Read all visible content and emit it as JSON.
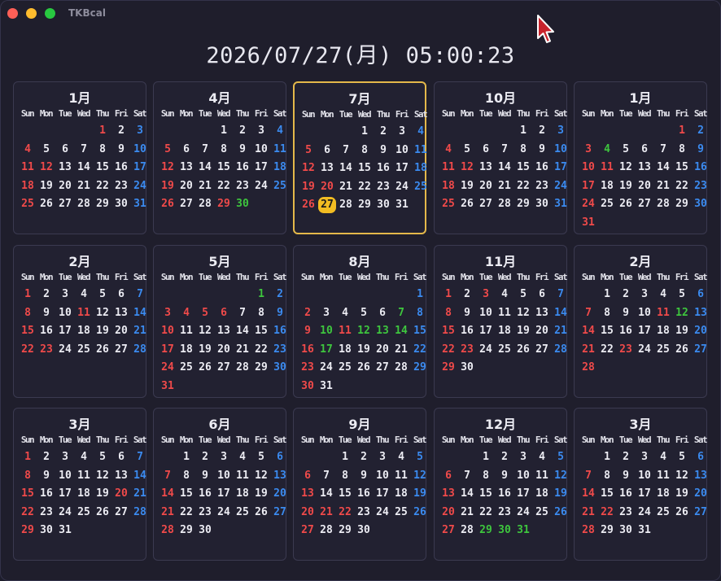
{
  "app": {
    "title": "TKBcal"
  },
  "clock": {
    "text": "2026/07/27(月) 05:00:23"
  },
  "weekdays": [
    "Sun",
    "Mon",
    "Tue",
    "Wed",
    "Thu",
    "Fri",
    "Sat"
  ],
  "colors": {
    "sunday": "#f04a4a",
    "saturday": "#3b8bf0",
    "holiday": "#f04a4a",
    "green": "#3ec63e",
    "today": "#f2bc22",
    "current_border": "#e4b84a"
  },
  "months": [
    {
      "title": "1月",
      "start": 4,
      "days": 31,
      "red": [
        1,
        12
      ],
      "green": []
    },
    {
      "title": "4月",
      "start": 3,
      "days": 30,
      "red": [
        29
      ],
      "green": [
        30
      ]
    },
    {
      "title": "7月",
      "start": 3,
      "days": 31,
      "red": [
        20
      ],
      "green": [],
      "today": 27,
      "current": true
    },
    {
      "title": "10月",
      "start": 4,
      "days": 31,
      "red": [
        12
      ],
      "green": []
    },
    {
      "title": "1月",
      "start": 5,
      "days": 31,
      "red": [
        1,
        11
      ],
      "green": [
        4
      ]
    },
    {
      "title": "2月",
      "start": 0,
      "days": 28,
      "red": [
        11,
        23
      ],
      "green": []
    },
    {
      "title": "5月",
      "start": 5,
      "days": 31,
      "red": [
        3,
        4,
        5,
        6
      ],
      "green": [
        1
      ]
    },
    {
      "title": "8月",
      "start": 6,
      "days": 31,
      "red": [
        11
      ],
      "green": [
        7,
        10,
        12,
        13,
        14,
        17
      ]
    },
    {
      "title": "11月",
      "start": 0,
      "days": 30,
      "red": [
        3,
        23
      ],
      "green": []
    },
    {
      "title": "2月",
      "start": 1,
      "days": 28,
      "red": [
        11,
        23
      ],
      "green": [
        12
      ]
    },
    {
      "title": "3月",
      "start": 0,
      "days": 31,
      "red": [
        20
      ],
      "green": []
    },
    {
      "title": "6月",
      "start": 1,
      "days": 30,
      "red": [],
      "green": []
    },
    {
      "title": "9月",
      "start": 2,
      "days": 30,
      "red": [
        21,
        22
      ],
      "green": []
    },
    {
      "title": "12月",
      "start": 2,
      "days": 31,
      "red": [],
      "green": [
        29,
        30,
        31
      ]
    },
    {
      "title": "3月",
      "start": 1,
      "days": 31,
      "red": [
        22
      ],
      "green": []
    }
  ]
}
